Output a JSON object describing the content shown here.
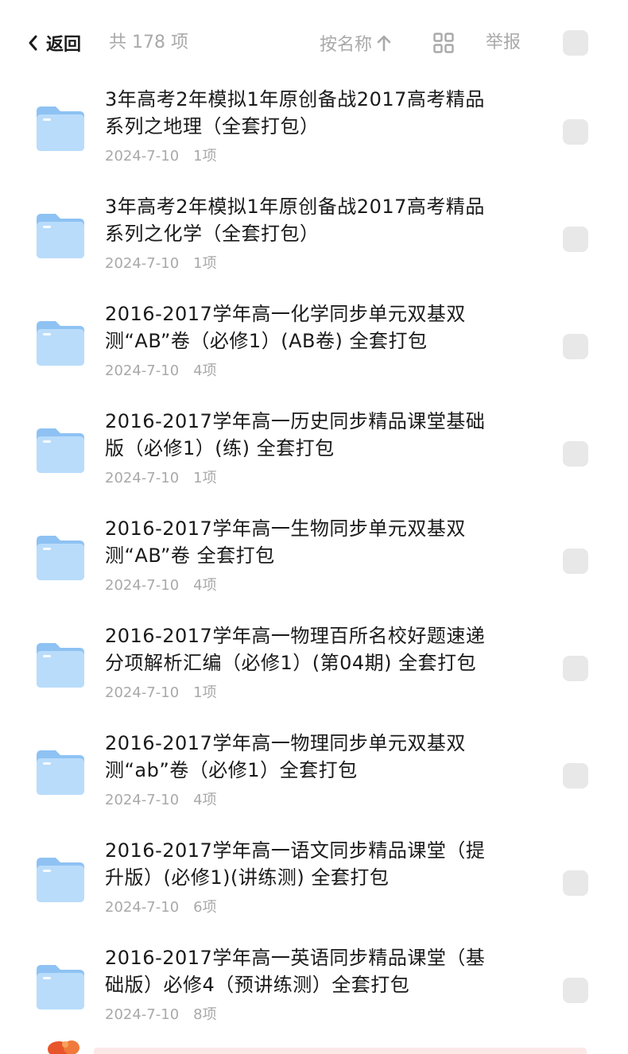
{
  "header": {
    "back_label": "返回",
    "count_text": "共 178 项",
    "sort_label": "按名称",
    "report_label": "举报"
  },
  "colors": {
    "folder_light": "#b9dcfb",
    "folder_dark": "#8ec2f3",
    "muted_text": "#a9a9a9",
    "checkbox": "#e8e8e8"
  },
  "icons": {
    "back": "chevron-left-icon",
    "sort": "arrow-up-icon",
    "grid": "grid-view-icon",
    "folder": "folder-icon"
  },
  "items": [
    {
      "title": "3年高考2年模拟1年原创备战2017高考精品\n系列之地理（全套打包）",
      "date": "2024-7-10",
      "count": "1项"
    },
    {
      "title": "3年高考2年模拟1年原创备战2017高考精品\n系列之化学（全套打包）",
      "date": "2024-7-10",
      "count": "1项"
    },
    {
      "title": "2016-2017学年高一化学同步单元双基双\n测“AB”卷（必修1）(AB卷) 全套打包",
      "date": "2024-7-10",
      "count": "4项"
    },
    {
      "title": "2016-2017学年高一历史同步精品课堂基础\n版（必修1）(练) 全套打包",
      "date": "2024-7-10",
      "count": "1项"
    },
    {
      "title": "2016-2017学年高一生物同步单元双基双\n测“AB”卷 全套打包",
      "date": "2024-7-10",
      "count": "4项"
    },
    {
      "title": "2016-2017学年高一物理百所名校好题速递\n分项解析汇编（必修1）(第04期) 全套打包",
      "date": "2024-7-10",
      "count": "1项"
    },
    {
      "title": "2016-2017学年高一物理同步单元双基双\n测“ab”卷（必修1）全套打包",
      "date": "2024-7-10",
      "count": "4项"
    },
    {
      "title": "2016-2017学年高一语文同步精品课堂（提\n升版）(必修1)(讲练测) 全套打包",
      "date": "2024-7-10",
      "count": "6项"
    },
    {
      "title": "2016-2017学年高一英语同步精品课堂（基\n础版）必修4（预讲练测）全套打包",
      "date": "2024-7-10",
      "count": "8项"
    }
  ]
}
